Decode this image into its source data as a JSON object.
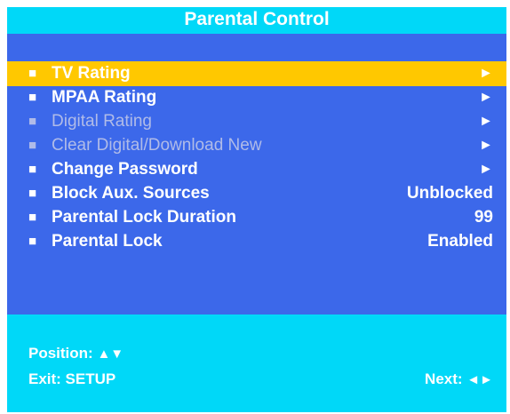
{
  "title": "Parental Control",
  "colors": {
    "background": "#00d8f8",
    "menu": "#3c68ea",
    "highlight": "#ffc800",
    "text": "#ffffff",
    "disabled_text": "#b0bbe8"
  },
  "menu": {
    "bullet": "■",
    "items": [
      {
        "label": "TV Rating",
        "value": "►",
        "selected": true,
        "enabled": true
      },
      {
        "label": "MPAA Rating",
        "value": "►",
        "selected": false,
        "enabled": true
      },
      {
        "label": "Digital Rating",
        "value": "►",
        "selected": false,
        "enabled": false
      },
      {
        "label": "Clear Digital/Download New",
        "value": "►",
        "selected": false,
        "enabled": false
      },
      {
        "label": "Change Password",
        "value": "►",
        "selected": false,
        "enabled": true
      },
      {
        "label": "Block Aux. Sources",
        "value": "Unblocked",
        "selected": false,
        "enabled": true
      },
      {
        "label": "Parental Lock Duration",
        "value": "99",
        "selected": false,
        "enabled": true
      },
      {
        "label": "Parental Lock",
        "value": "Enabled",
        "selected": false,
        "enabled": true
      }
    ]
  },
  "footer": {
    "position_label": "Position:",
    "position_keys": "▲▼",
    "exit_label": "Exit: SETUP",
    "next_label": "Next:",
    "next_keys": "◄►"
  }
}
